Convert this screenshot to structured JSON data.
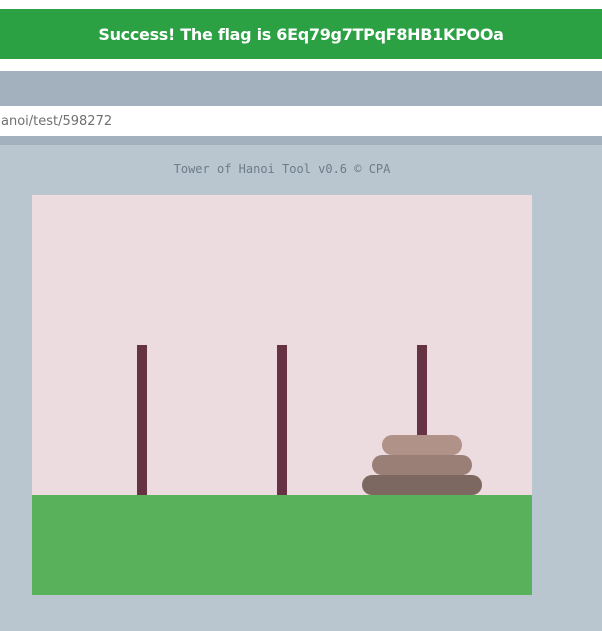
{
  "banner": {
    "text": "Success! The flag is 6Eq79g7TPqF8HB1KPOOa",
    "color": "#2ba144"
  },
  "url_bar": {
    "text": "anoi/test/598272"
  },
  "tool": {
    "title": "Tower of Hanoi Tool v0.6 © CPA"
  },
  "game": {
    "pegs": [
      {
        "index": 0,
        "disks": []
      },
      {
        "index": 1,
        "disks": []
      },
      {
        "index": 2,
        "disks": [
          {
            "size": "large",
            "color": "#7d6861"
          },
          {
            "size": "medium",
            "color": "#9a7f77"
          },
          {
            "size": "small",
            "color": "#b19288"
          }
        ]
      }
    ],
    "colors": {
      "background": "#ecdce0",
      "ground": "#59b15b",
      "peg": "#653344"
    }
  }
}
